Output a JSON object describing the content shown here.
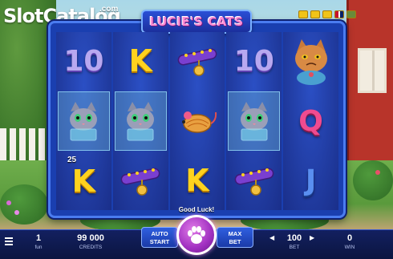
{
  "header": {
    "site_logo_main": "SlotCatalog",
    "site_logo_suffix": ".com",
    "game_title": "LUCIE'S CATS"
  },
  "reels": [
    [
      {
        "type": "number",
        "label": "10"
      },
      {
        "type": "cat",
        "label": ""
      },
      {
        "type": "k",
        "label": "K",
        "badge": "25"
      }
    ],
    [
      {
        "type": "k",
        "label": "K"
      },
      {
        "type": "cat",
        "label": ""
      },
      {
        "type": "collar",
        "label": ""
      }
    ],
    [
      {
        "type": "collar",
        "label": ""
      },
      {
        "type": "mouse",
        "label": ""
      },
      {
        "type": "k",
        "label": "K"
      }
    ],
    [
      {
        "type": "number",
        "label": "10"
      },
      {
        "type": "cat",
        "label": ""
      },
      {
        "type": "collar",
        "label": ""
      }
    ],
    [
      {
        "type": "bigcat",
        "label": ""
      },
      {
        "type": "q",
        "label": "Q"
      },
      {
        "type": "j",
        "label": "J"
      }
    ]
  ],
  "status": {
    "message": "Good Luck!"
  },
  "bottom_bar": {
    "lines_value": "1",
    "lines_label": "fun",
    "credits_value": "99 000",
    "credits_label": "CREDITS",
    "auto_start_label_1": "AUTO",
    "auto_start_label_2": "START",
    "max_bet_label_1": "MAX",
    "max_bet_label_2": "BET",
    "bet_value": "100",
    "bet_label": "BET",
    "win_value": "0",
    "win_label": "WIN",
    "bet_decrease": "◀",
    "bet_increase": "▶"
  },
  "colors": {
    "frame_blue": "#1a3fb0",
    "spin_purple": "#a030c0",
    "k_yellow": "#ffd21e",
    "q_pink": "#f04b90"
  }
}
